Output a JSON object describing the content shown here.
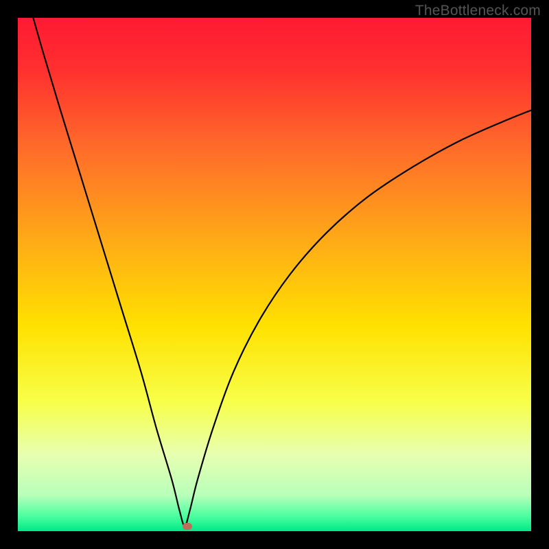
{
  "watermark": "TheBottleneck.com",
  "chart_data": {
    "type": "line",
    "title": "",
    "xlabel": "",
    "ylabel": "",
    "xlim": [
      0,
      100
    ],
    "ylim": [
      0,
      100
    ],
    "gradient_stops": [
      {
        "pos": 0.0,
        "color": "#ff1a33"
      },
      {
        "pos": 0.1,
        "color": "#ff2f2f"
      },
      {
        "pos": 0.25,
        "color": "#ff6a2a"
      },
      {
        "pos": 0.45,
        "color": "#ffb015"
      },
      {
        "pos": 0.6,
        "color": "#ffe100"
      },
      {
        "pos": 0.75,
        "color": "#f7ff4a"
      },
      {
        "pos": 0.85,
        "color": "#e8ffb0"
      },
      {
        "pos": 0.93,
        "color": "#b8ffba"
      },
      {
        "pos": 0.97,
        "color": "#4dffa0"
      },
      {
        "pos": 1.0,
        "color": "#00e887"
      }
    ],
    "series": [
      {
        "name": "bottleneck-curve",
        "x": [
          3,
          5,
          8,
          12,
          16,
          20,
          24,
          27,
          30,
          31.5,
          32.5,
          33.5,
          35,
          38,
          42,
          47,
          53,
          60,
          68,
          77,
          86,
          95,
          100
        ],
        "y": [
          100,
          93,
          83,
          70,
          57,
          44,
          31,
          20,
          10,
          4,
          1,
          4,
          10,
          20,
          31,
          41,
          50,
          58,
          65,
          71,
          76,
          80,
          82
        ]
      }
    ],
    "marker": {
      "x": 33,
      "y": 1,
      "color": "#c46a5a"
    }
  }
}
